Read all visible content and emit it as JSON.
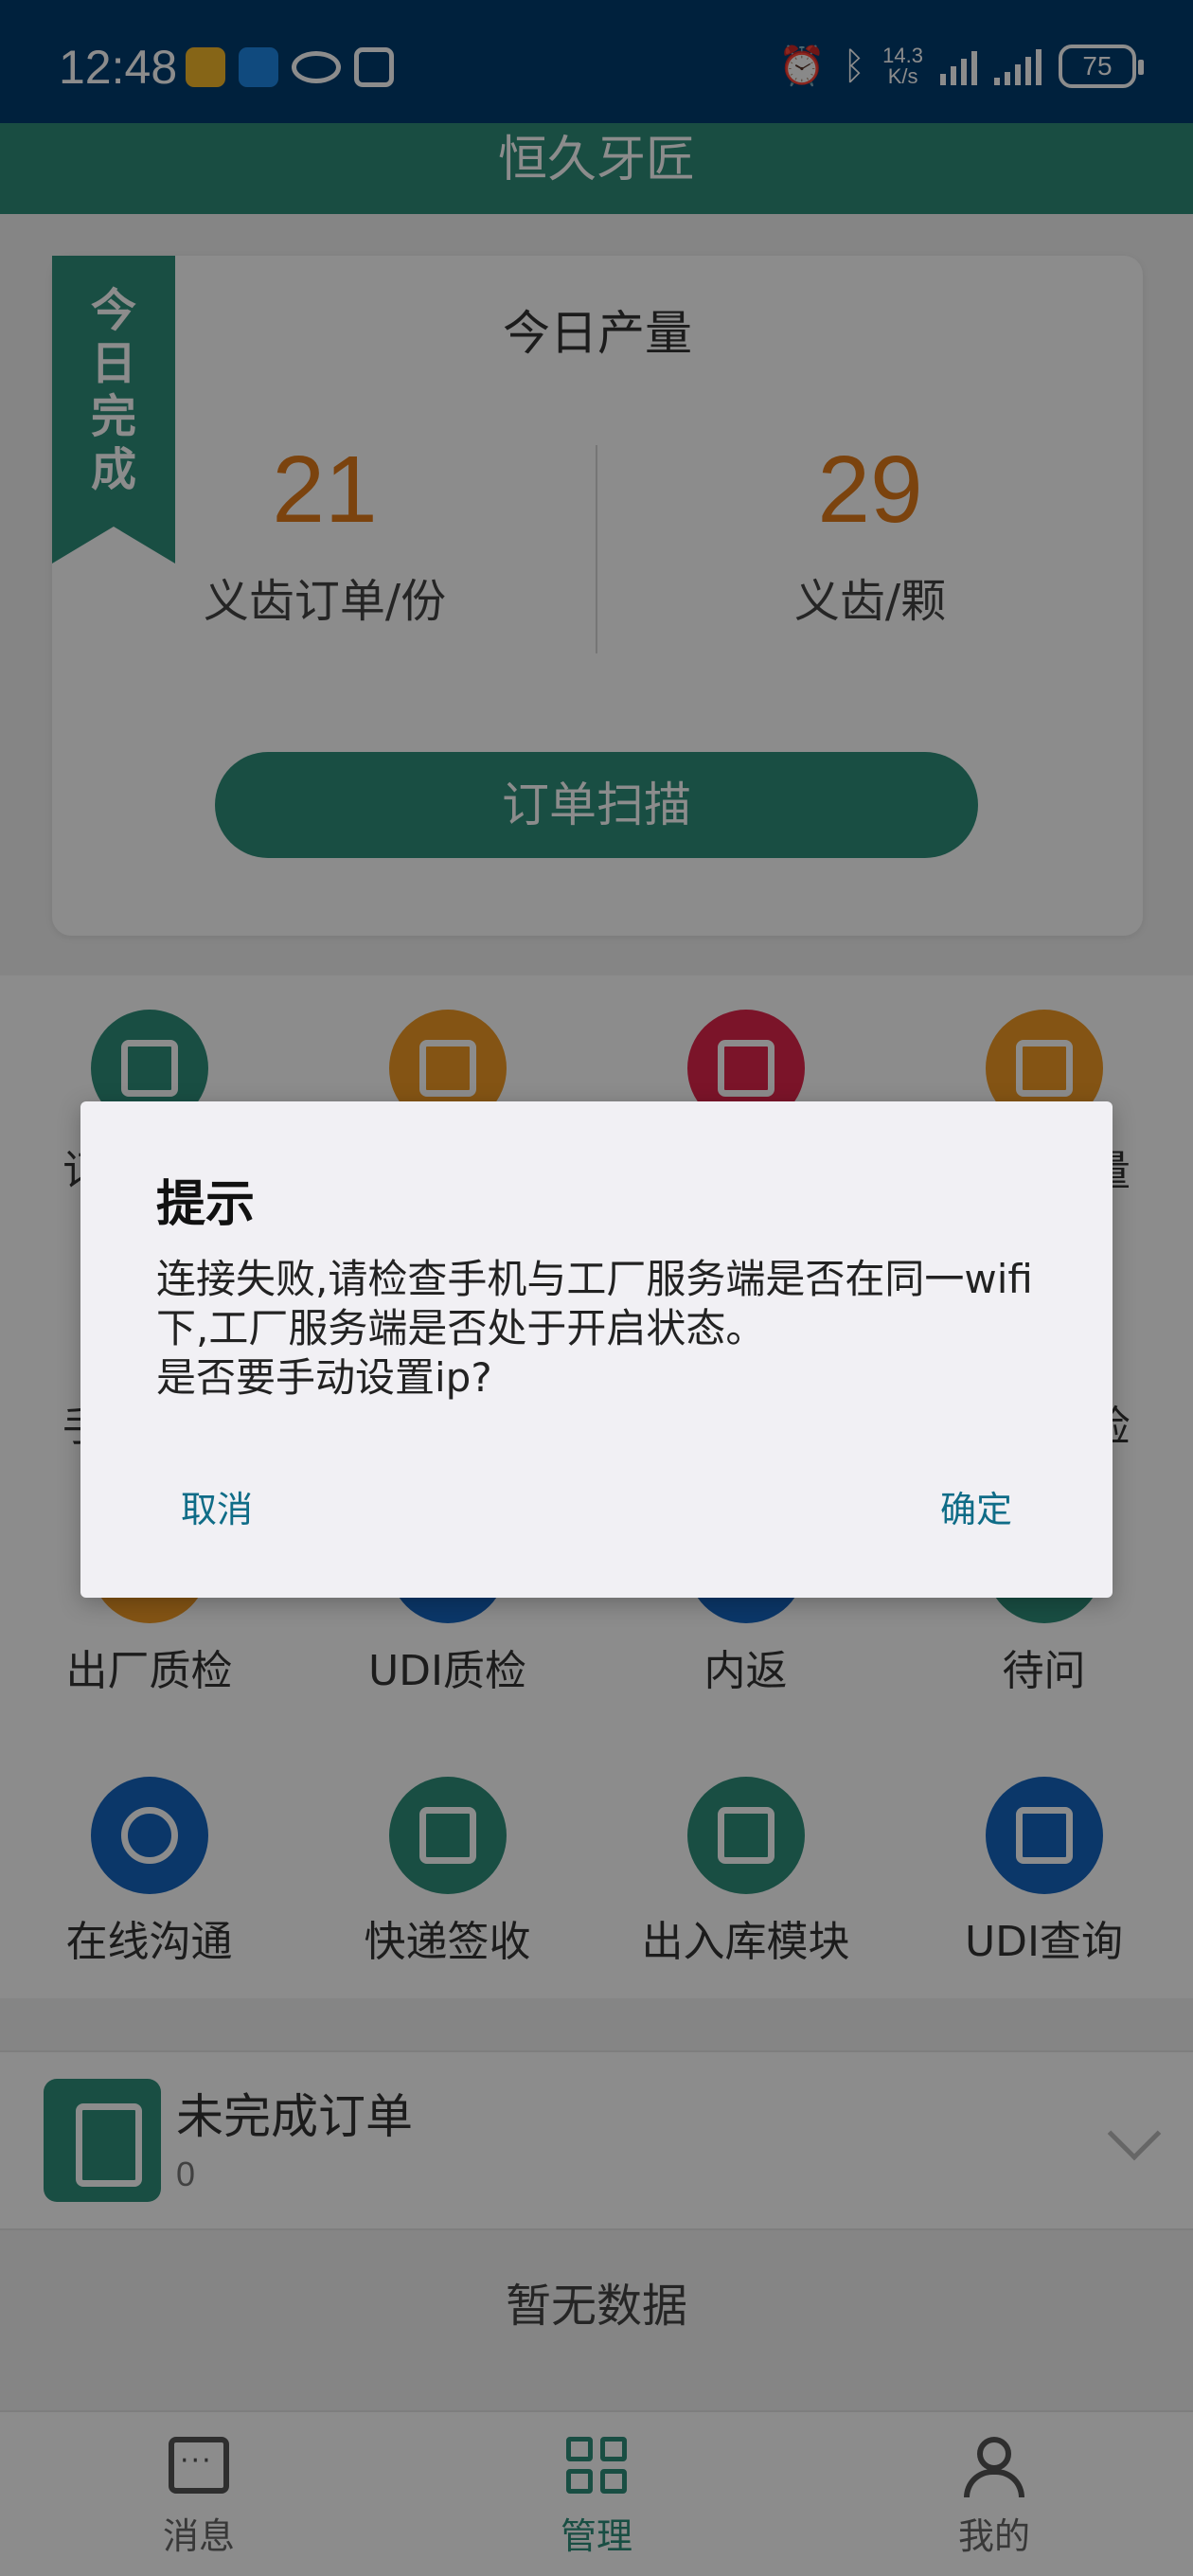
{
  "status_bar": {
    "time": "12:48",
    "net_speed_value": "14.3",
    "net_speed_unit": "K/s",
    "battery": "75"
  },
  "header": {
    "title": "恒久牙匠"
  },
  "daily_card": {
    "ribbon": [
      "今",
      "日",
      "完",
      "成"
    ],
    "title": "今日产量",
    "stats": [
      {
        "value": "21",
        "label": "义齿订单/份"
      },
      {
        "value": "29",
        "label": "义齿/颗"
      }
    ],
    "scan_button": "订单扫描"
  },
  "grid": {
    "partial_labels": {
      "row1_left": "订",
      "row1_right": "量",
      "row2_left": "手",
      "row2_right": "检"
    },
    "row3": [
      {
        "label": "出厂质检"
      },
      {
        "label": "UDI质检"
      },
      {
        "label": "内返"
      },
      {
        "label": "待问"
      }
    ],
    "row4": [
      {
        "label": "在线沟通",
        "icon": "chat-icon"
      },
      {
        "label": "快递签收",
        "icon": "package-sign-icon"
      },
      {
        "label": "出入库模块",
        "icon": "stack-icon"
      },
      {
        "label": "UDI查询",
        "icon": "document-icon"
      }
    ]
  },
  "pending": {
    "title": "未完成订单",
    "count": "0",
    "empty_text": "暂无数据"
  },
  "tabbar": {
    "tabs": [
      {
        "label": "消息",
        "icon": "message-icon"
      },
      {
        "label": "管理",
        "icon": "grid-icon"
      },
      {
        "label": "我的",
        "icon": "user-icon"
      }
    ]
  },
  "dialog": {
    "title": "提示",
    "message": "连接失败,请检查手机与工厂服务端是否在同一wifi下,工厂服务端是否处于开启状态。\n是否要手动设置ip?",
    "cancel": "取消",
    "confirm": "确定"
  },
  "colors": {
    "primary": "#2f8f7b",
    "stat_value": "#e07a1a",
    "status_bar": "#003d70",
    "dialog_button": "#0f6c87"
  }
}
